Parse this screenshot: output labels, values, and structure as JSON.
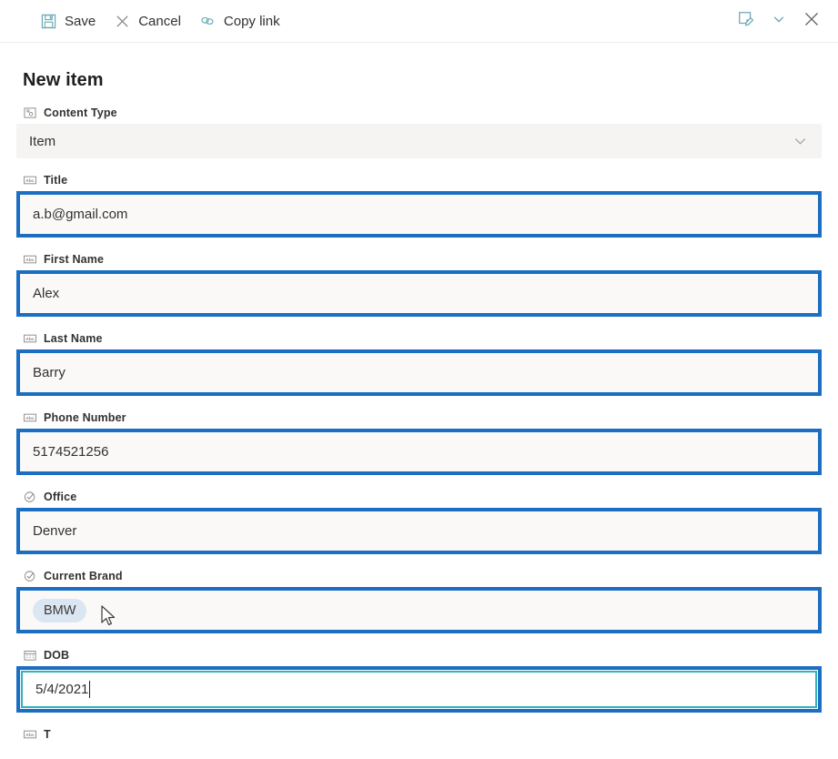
{
  "toolbar": {
    "save": {
      "label": "Save",
      "icon": "save-icon"
    },
    "cancel": {
      "label": "Cancel",
      "icon": "close-icon"
    },
    "copy_link": {
      "label": "Copy link",
      "icon": "link-icon"
    },
    "edit_form_icon": "edit-form-icon",
    "more_icon": "chevron-down-icon",
    "close_icon": "close-panel-icon"
  },
  "page": {
    "title": "New item"
  },
  "colors": {
    "highlight_border": "#1b6ec2",
    "focus_border": "#30b5bd",
    "pill_background": "#dbe6f3",
    "toolbar_icon": "#6ba8b5",
    "field_background": "#faf9f8",
    "disabled_background": "#f5f4f3"
  },
  "fields": [
    {
      "name": "content-type",
      "label": "Content Type",
      "icon": "content-type-icon",
      "value": "Item",
      "style": "dropdown",
      "highlighted": false,
      "focused": false
    },
    {
      "name": "title",
      "label": "Title",
      "icon": "text-abc-icon",
      "value": "a.b@gmail.com",
      "style": "text",
      "highlighted": true,
      "focused": false
    },
    {
      "name": "first-name",
      "label": "First Name",
      "icon": "text-abc-icon",
      "value": "Alex",
      "style": "text",
      "highlighted": true,
      "focused": false
    },
    {
      "name": "last-name",
      "label": "Last Name",
      "icon": "text-abc-icon",
      "value": "Barry",
      "style": "text",
      "highlighted": true,
      "focused": false
    },
    {
      "name": "phone-number",
      "label": "Phone Number",
      "icon": "text-abc-icon",
      "value": "5174521256",
      "style": "text",
      "highlighted": true,
      "focused": false
    },
    {
      "name": "office",
      "label": "Office",
      "icon": "choice-check-icon",
      "value": "Denver",
      "style": "text",
      "highlighted": true,
      "focused": false
    },
    {
      "name": "current-brand",
      "label": "Current Brand",
      "icon": "choice-check-icon",
      "value": "BMW",
      "style": "pill",
      "highlighted": true,
      "focused": false
    },
    {
      "name": "dob",
      "label": "DOB",
      "icon": "calendar-icon",
      "value": "5/4/2021",
      "style": "text",
      "highlighted": true,
      "focused": true
    },
    {
      "name": "next-field",
      "label": "T",
      "icon": "text-abc-icon",
      "value": "",
      "style": "text",
      "highlighted": false,
      "focused": false
    }
  ]
}
